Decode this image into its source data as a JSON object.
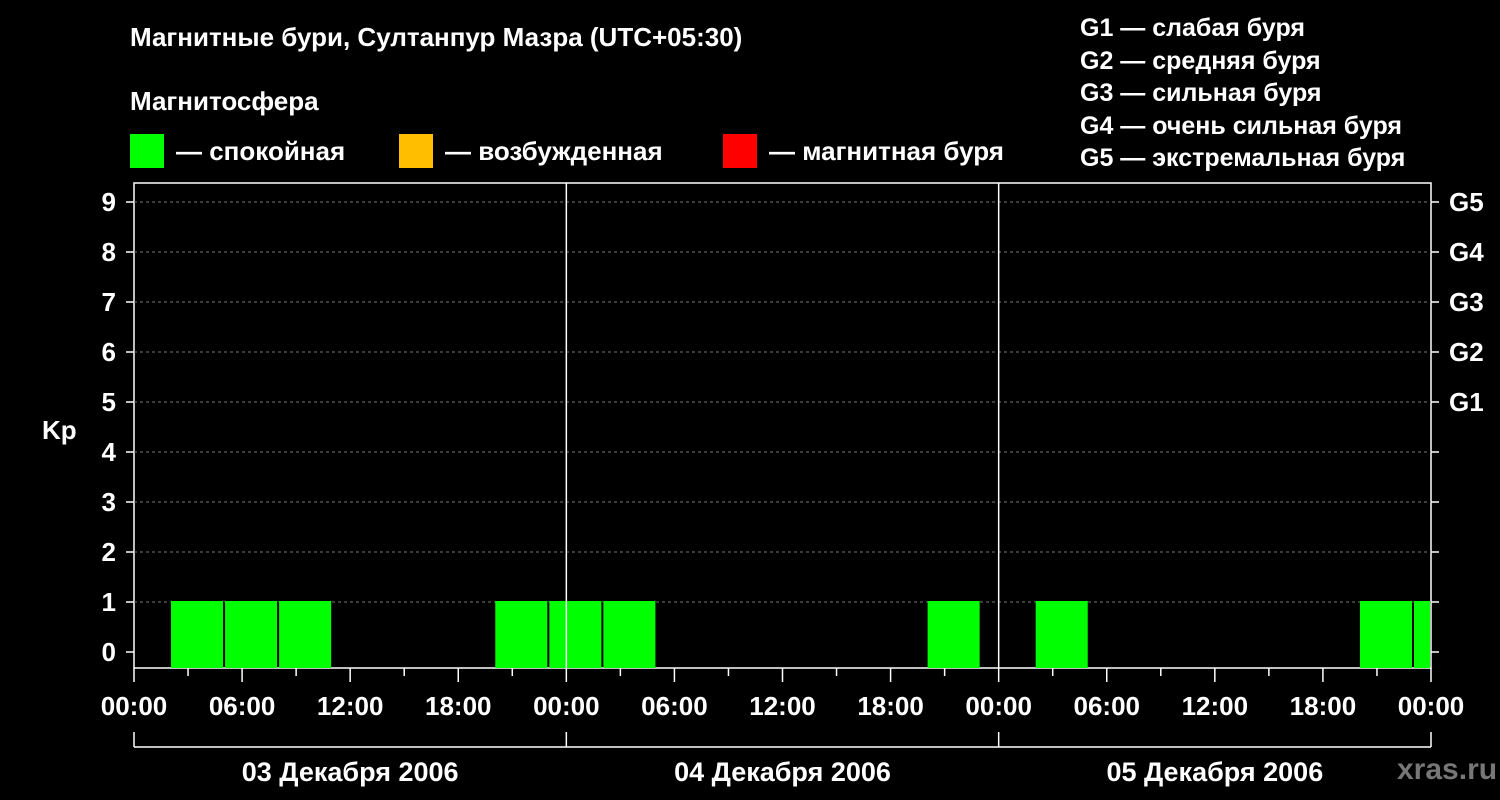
{
  "title": "Магнитные бури, Султанпур Мазра (UTC+05:30)",
  "section_title": "Магнитосфера",
  "legend": [
    {
      "label": "— спокойная",
      "color": "#00ff00"
    },
    {
      "label": "— возбужденная",
      "color": "#ffbf00"
    },
    {
      "label": "— магнитная буря",
      "color": "#ff0000"
    }
  ],
  "g_legend": [
    "G1 — слабая буря",
    "G2 — средняя буря",
    "G3 — сильная буря",
    "G4 — очень сильная буря",
    "G5 — экстремальная буря"
  ],
  "watermark": "xras.ru",
  "chart_data": {
    "type": "bar",
    "ylabel": "Kp",
    "ylim": [
      0,
      9
    ],
    "yticks": [
      "0",
      "1",
      "2",
      "3",
      "4",
      "5",
      "6",
      "7",
      "8",
      "9"
    ],
    "right_axis_labels": [
      {
        "kp": 5,
        "label": "G1"
      },
      {
        "kp": 6,
        "label": "G2"
      },
      {
        "kp": 7,
        "label": "G3"
      },
      {
        "kp": 8,
        "label": "G4"
      },
      {
        "kp": 9,
        "label": "G5"
      }
    ],
    "x_range_hours": [
      0,
      72
    ],
    "xtick_labels": [
      "00:00",
      "06:00",
      "12:00",
      "18:00",
      "00:00",
      "06:00",
      "12:00",
      "18:00",
      "00:00",
      "06:00",
      "12:00",
      "18:00",
      "00:00"
    ],
    "days": [
      "03 Декабря 2006",
      "04 Декабря 2006",
      "05 Декабря 2006"
    ],
    "grid": true,
    "bars": [
      {
        "start_hour": 2.0,
        "kp": 1,
        "level": "спокойная"
      },
      {
        "start_hour": 5.0,
        "kp": 1,
        "level": "спокойная"
      },
      {
        "start_hour": 8.0,
        "kp": 1,
        "level": "спокойная"
      },
      {
        "start_hour": 20.0,
        "kp": 1,
        "level": "спокойная"
      },
      {
        "start_hour": 23.0,
        "kp": 1,
        "level": "спокойная"
      },
      {
        "start_hour": 26.0,
        "kp": 1,
        "level": "спокойная"
      },
      {
        "start_hour": 44.0,
        "kp": 1,
        "level": "спокойная"
      },
      {
        "start_hour": 50.0,
        "kp": 1,
        "level": "спокойная"
      },
      {
        "start_hour": 68.0,
        "kp": 1,
        "level": "спокойная"
      },
      {
        "start_hour": 71.0,
        "kp": 1,
        "level": "спокойная"
      }
    ]
  }
}
